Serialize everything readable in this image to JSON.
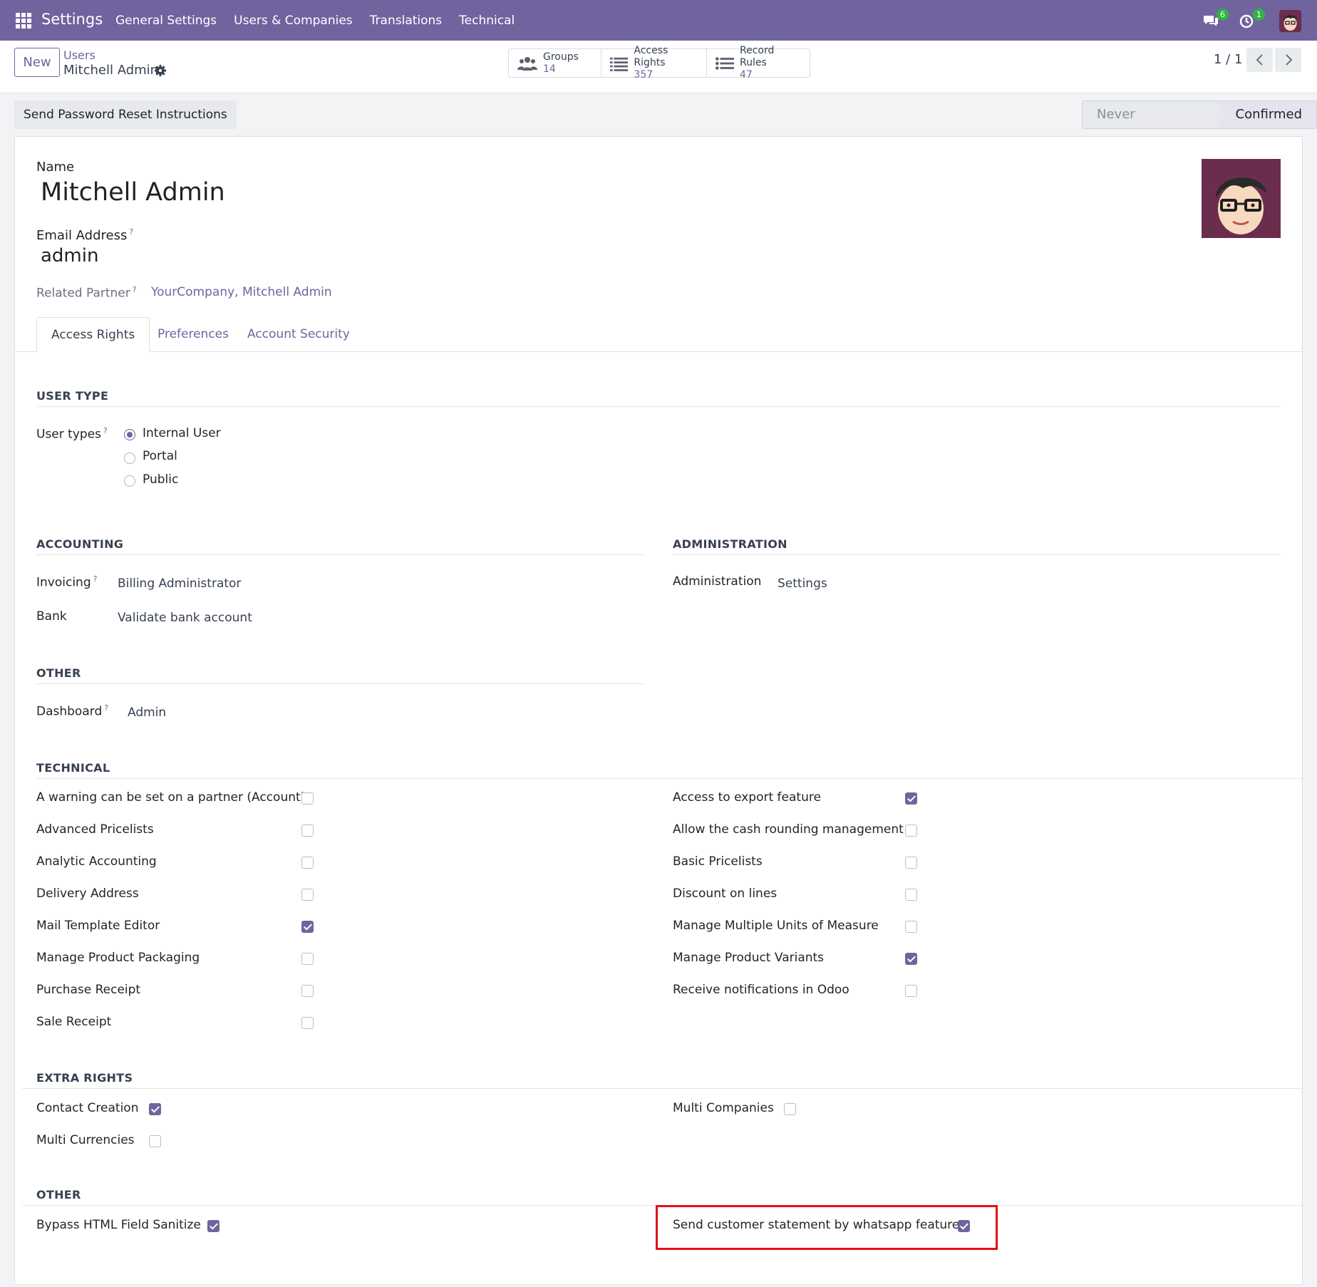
{
  "topbar": {
    "brand": "Settings",
    "menu": [
      "General Settings",
      "Users & Companies",
      "Translations",
      "Technical"
    ],
    "messages_count": "6",
    "activities_count": "1"
  },
  "control": {
    "new_label": "New",
    "breadcrumb_parent": "Users",
    "breadcrumb_current": "Mitchell Admin",
    "smart_buttons": [
      {
        "label": "Groups",
        "value": "14",
        "icon": "users-icon"
      },
      {
        "label": "Access Rights",
        "value": "357",
        "icon": "list-icon"
      },
      {
        "label": "Record Rules",
        "value": "47",
        "icon": "list-icon"
      }
    ],
    "pager": "1 / 1"
  },
  "action": {
    "reset_label": "Send Password Reset Instructions",
    "status": [
      "Never Connected",
      "Confirmed"
    ]
  },
  "form": {
    "name_label": "Name",
    "name_value": "Mitchell Admin",
    "email_label": "Email Address",
    "email_value": "admin",
    "related_partner_label": "Related Partner",
    "related_partner_value": "YourCompany, Mitchell Admin",
    "help_mark": "?",
    "tabs": [
      "Access Rights",
      "Preferences",
      "Account Security"
    ]
  },
  "user_type": {
    "title": "USER TYPE",
    "label": "User types",
    "options": [
      "Internal User",
      "Portal",
      "Public"
    ],
    "selected": "Internal User"
  },
  "accounting": {
    "title": "ACCOUNTING",
    "invoicing_label": "Invoicing",
    "invoicing_value": "Billing Administrator",
    "bank_label": "Bank",
    "bank_value": "Validate bank account"
  },
  "administration": {
    "title": "ADMINISTRATION",
    "label": "Administration",
    "value": "Settings"
  },
  "other1": {
    "title": "OTHER",
    "dashboard_label": "Dashboard",
    "dashboard_value": "Admin"
  },
  "technical": {
    "title": "TECHNICAL",
    "left": [
      {
        "label": "A warning can be set on a partner (Account)",
        "checked": false
      },
      {
        "label": "Advanced Pricelists",
        "checked": false
      },
      {
        "label": "Analytic Accounting",
        "checked": false
      },
      {
        "label": "Delivery Address",
        "checked": false
      },
      {
        "label": "Mail Template Editor",
        "checked": true
      },
      {
        "label": "Manage Product Packaging",
        "checked": false
      },
      {
        "label": "Purchase Receipt",
        "checked": false
      },
      {
        "label": "Sale Receipt",
        "checked": false
      }
    ],
    "right": [
      {
        "label": "Access to export feature",
        "checked": true
      },
      {
        "label": "Allow the cash rounding management",
        "checked": false
      },
      {
        "label": "Basic Pricelists",
        "checked": false
      },
      {
        "label": "Discount on lines",
        "checked": false
      },
      {
        "label": "Manage Multiple Units of Measure",
        "checked": false
      },
      {
        "label": "Manage Product Variants",
        "checked": true
      },
      {
        "label": "Receive notifications in Odoo",
        "checked": false
      }
    ]
  },
  "extra_rights": {
    "title": "EXTRA RIGHTS",
    "contact_creation": {
      "label": "Contact Creation",
      "checked": true
    },
    "multi_currencies": {
      "label": "Multi Currencies",
      "checked": false
    },
    "multi_companies": {
      "label": "Multi Companies",
      "checked": false
    }
  },
  "other2": {
    "title": "OTHER",
    "bypass_html": {
      "label": "Bypass HTML Field Sanitize",
      "checked": true
    },
    "whatsapp_statement": {
      "label": "Send customer statement by whatsapp feature",
      "checked": true
    }
  },
  "colors": {
    "brand": "#71639e",
    "highlight": "#e0101a"
  }
}
